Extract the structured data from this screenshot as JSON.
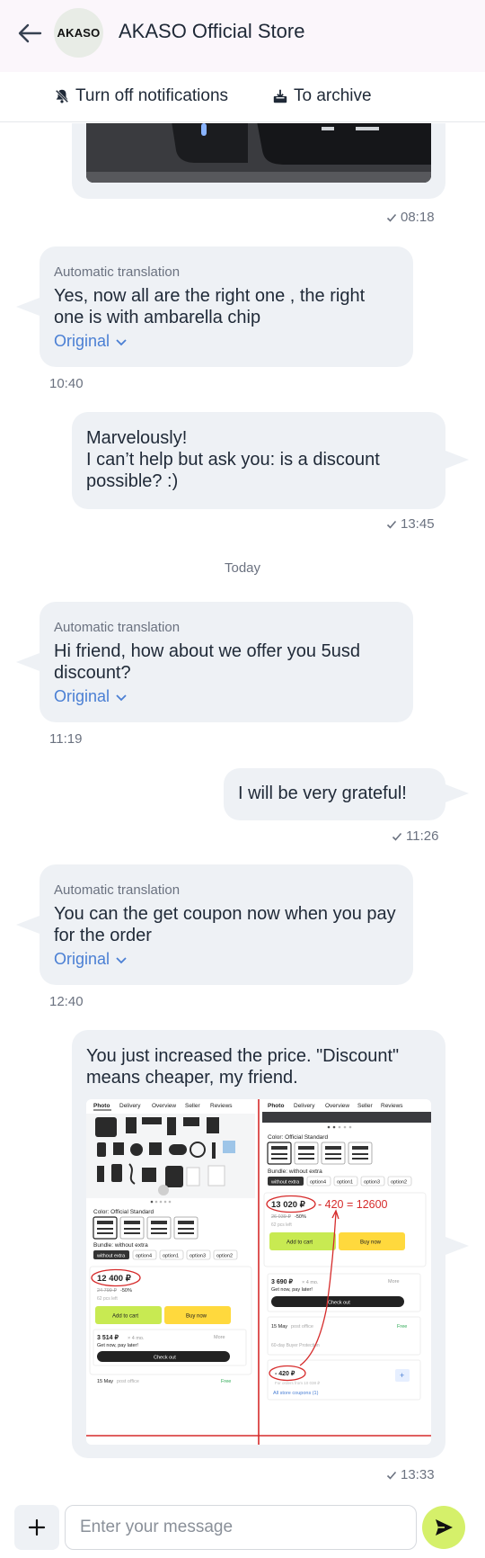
{
  "header": {
    "avatar_text": "AKASO",
    "store_title": "AKASO Official Store"
  },
  "actions": {
    "notifications_label": "Turn off notifications",
    "archive_label": "To archive"
  },
  "messages": [
    {
      "id": "m1",
      "time": "08:18"
    },
    {
      "id": "m2",
      "auto_label": "Automatic translation",
      "text": "Yes, now all are the right one , the right one is with ambarella chip",
      "original_label": "Original",
      "time": "10:40"
    },
    {
      "id": "m3",
      "line1": "Marvelously!",
      "line2": "I can’t help but ask you: is a discount possible? :)",
      "time": "13:45"
    },
    {
      "id": "m4",
      "auto_label": "Automatic translation",
      "text": "Hi friend, how about we offer you 5usd discount?",
      "original_label": "Original",
      "time": "11:19"
    },
    {
      "id": "m5",
      "text": "I will be very grateful!",
      "time": "11:26"
    },
    {
      "id": "m6",
      "auto_label": "Automatic translation",
      "text": "You can the get coupon now when you pay for the order",
      "original_label": "Original",
      "time": "12:40"
    },
    {
      "id": "m7",
      "text": "You just increased the price. \"Discount\" means cheaper, my friend.",
      "time": "13:33"
    }
  ],
  "date_separator": "Today",
  "screenshot": {
    "tabs": [
      "Photo",
      "Delivery",
      "Overview",
      "Seller",
      "Reviews"
    ],
    "color_label": "Color: Official Standard",
    "bundle_label": "Bundle: without extra",
    "options": [
      "without extra",
      "option4",
      "option1",
      "option3",
      "option2"
    ],
    "left": {
      "price": "12 400 ₽",
      "old_price": "24 799 ₽",
      "discount": "-50%",
      "stock": "62 pcs left",
      "add_to_cart": "Add to cart",
      "buy_now": "Buy now",
      "installment": "3 514 ₽",
      "installment_suffix": "× 4 mo.",
      "pay_later": "Get now, pay later!",
      "more": "More",
      "checkout": "Check out",
      "delivery_date": "15 May",
      "delivery_type": "post office",
      "delivery_free": "Free"
    },
    "right": {
      "price": "13 020 ₽",
      "annotation": "- 420 = 12600",
      "old_price": "26 039 ₽",
      "discount": "-50%",
      "stock": "62 pcs left",
      "add_to_cart": "Add to cart",
      "buy_now": "Buy now",
      "installment": "3 690 ₽",
      "installment_suffix": "× 4 mo.",
      "pay_later": "Get now, pay later!",
      "more": "More",
      "checkout": "Check out",
      "delivery_date": "15 May",
      "delivery_type": "post office",
      "delivery_free": "Free",
      "protection": "60-day Buyer Protection",
      "coupon": "- 420 ₽",
      "coupon_note": "For orders from 10 038 ₽",
      "all_coupons": "All store coupons (1)"
    }
  },
  "composer": {
    "placeholder": "Enter your message"
  },
  "colors": {
    "bubble": "#eef1f5",
    "link": "#4a7fd4",
    "send": "#d5f06a",
    "header_bg": "#fbf6fb",
    "annotation_red": "#d62b2b"
  },
  "icons": [
    "back-arrow-icon",
    "bell-off-icon",
    "archive-icon",
    "chevron-down-icon",
    "check-icon",
    "plus-icon",
    "send-icon"
  ]
}
